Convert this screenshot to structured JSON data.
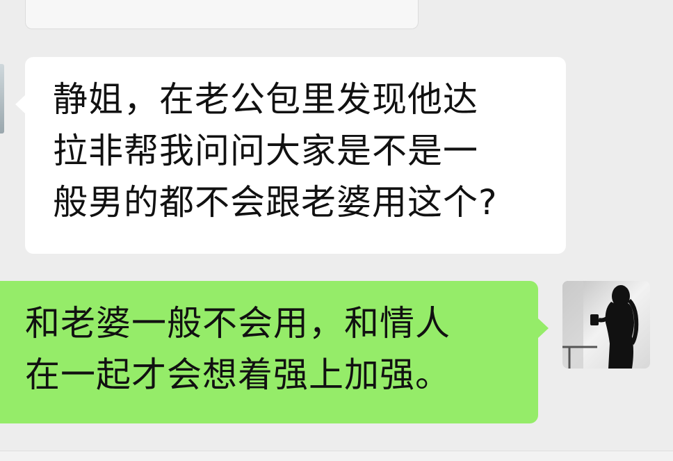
{
  "messages": [
    {
      "direction": "incoming",
      "bubble_color": "#ffffff",
      "text": "静姐，在老公包里发现他达\n拉非帮我问问大家是不是一\n般男的都不会跟老婆用这个?"
    },
    {
      "direction": "outgoing",
      "bubble_color": "#95ec69",
      "text": "和老婆一般不会用，和情人\n在一起才会想着强上加强。"
    }
  ],
  "outgoing_avatar": {
    "icon": "silhouette-photo-avatar"
  },
  "background_color": "#ededed"
}
